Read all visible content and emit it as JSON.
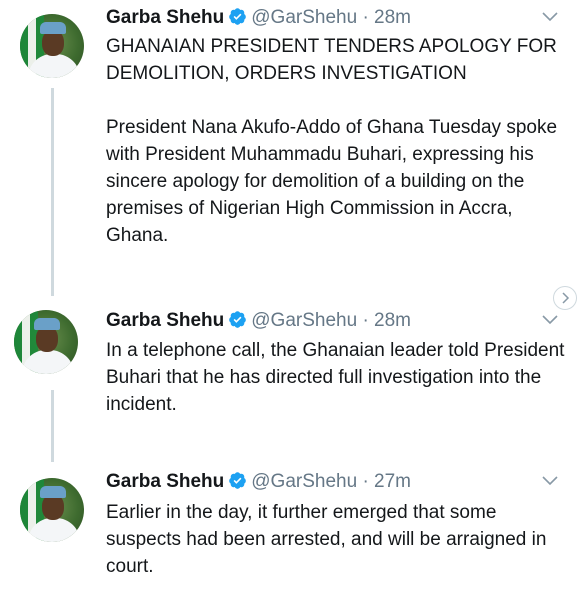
{
  "tweets": [
    {
      "name": "Garba Shehu",
      "handle": "@GarShehu",
      "separator": "·",
      "time": "28m",
      "paragraphs": [
        "GHANAIAN PRESIDENT TENDERS APOLOGY FOR DEMOLITION, ORDERS INVESTIGATION",
        "President Nana Akufo-Addo of Ghana Tuesday spoke with President Muhammadu Buhari, expressing his sincere apology for demolition of a building on the premises of Nigerian High Commission in Accra, Ghana."
      ]
    },
    {
      "name": "Garba Shehu",
      "handle": "@GarShehu",
      "separator": "·",
      "time": "28m",
      "paragraphs": [
        "In a telephone call, the Ghanaian leader told President Buhari that he has directed full investigation into the incident."
      ]
    },
    {
      "name": "Garba Shehu",
      "handle": "@GarShehu",
      "separator": "·",
      "time": "27m",
      "paragraphs": [
        "Earlier in the day, it further emerged that some suspects had been arrested, and will be arraigned in court."
      ]
    }
  ],
  "icons": {
    "verified": "verified-badge-icon",
    "menu": "chevron-down-icon",
    "next": "chevron-right-icon"
  },
  "colors": {
    "verified": "#1da1f2",
    "secondary_text": "#657786",
    "thread_line": "#cfd9de"
  }
}
